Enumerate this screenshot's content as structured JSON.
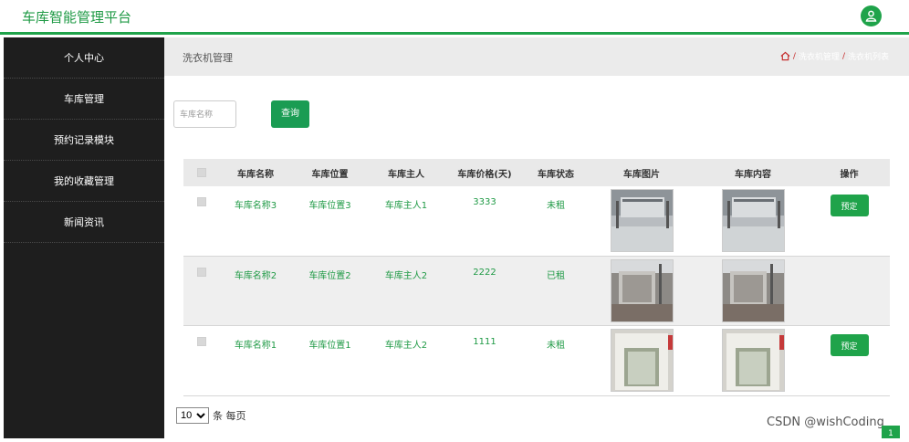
{
  "header": {
    "app_title": "车库智能管理平台",
    "user_icon": "user-icon"
  },
  "sidebar": {
    "items": [
      {
        "label": "个人中心"
      },
      {
        "label": "车库管理"
      },
      {
        "label": "预约记录模块"
      },
      {
        "label": "我的收藏管理"
      },
      {
        "label": "新闻资讯"
      }
    ]
  },
  "breadcrumb": {
    "title": "洗衣机管理",
    "path": [
      "洗衣机管理",
      "洗衣机列表"
    ]
  },
  "search": {
    "placeholder": "车库名称",
    "button_label": "查询"
  },
  "table": {
    "headers": [
      "",
      "车库名称",
      "车库位置",
      "车库主人",
      "车库价格(天)",
      "车库状态",
      "车库图片",
      "车库内容",
      "操作"
    ],
    "rows": [
      {
        "name": "车库名称3",
        "location": "车库位置3",
        "owner": "车库主人1",
        "price": "3333",
        "status": "未租",
        "action": "预定"
      },
      {
        "name": "车库名称2",
        "location": "车库位置2",
        "owner": "车库主人2",
        "price": "2222",
        "status": "已租",
        "action": ""
      },
      {
        "name": "车库名称1",
        "location": "车库位置1",
        "owner": "车库主人2",
        "price": "1111",
        "status": "未租",
        "action": "预定"
      }
    ]
  },
  "pagination": {
    "page_size": "10",
    "page_size_suffix": "条 每页",
    "current_page": "1"
  },
  "watermark": "CSDN @wishCoding",
  "colors": {
    "accent": "#1fa34a",
    "sidebar_bg": "#1e1e1e",
    "crumb_sep": "#c62f2f"
  }
}
